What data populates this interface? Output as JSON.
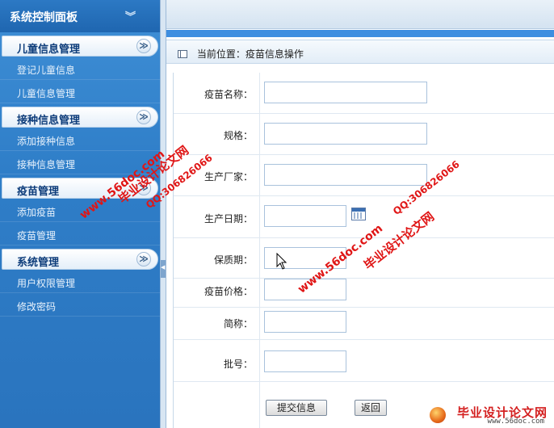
{
  "sidebar": {
    "title": "系统控制面板",
    "collapse_glyph": "≫",
    "groups": [
      {
        "title": "儿童信息管理",
        "items": [
          "登记儿童信息",
          "儿童信息管理"
        ]
      },
      {
        "title": "接种信息管理",
        "items": [
          "添加接种信息",
          "接种信息管理"
        ]
      },
      {
        "title": "疫苗管理",
        "items": [
          "添加疫苗",
          "疫苗管理"
        ]
      },
      {
        "title": "系统管理",
        "items": [
          "用户权限管理",
          "修改密码"
        ]
      }
    ]
  },
  "breadcrumb": {
    "text": "当前位置：疫苗信息操作"
  },
  "form": {
    "fields": [
      {
        "label": "疫苗名称：",
        "value": ""
      },
      {
        "label": "规格：",
        "value": ""
      },
      {
        "label": "生产厂家：",
        "value": ""
      },
      {
        "label": "生产日期：",
        "value": ""
      },
      {
        "label": "保质期：",
        "value": ""
      },
      {
        "label": "疫苗价格：",
        "value": ""
      },
      {
        "label": "简称：",
        "value": ""
      },
      {
        "label": "批号：",
        "value": ""
      }
    ],
    "submit_label": "提交信息",
    "back_label": "返回"
  },
  "watermark": {
    "site_name": "毕业设计论文网",
    "qq": "QQ:306826066",
    "url": "www.56doc.com",
    "footer_name": "毕业设计论文网",
    "footer_url": "www.56doc.com"
  },
  "icons": [
    "collapse-double-chevron-icon",
    "table-icon",
    "calendar-icon",
    "mouse-cursor-icon"
  ],
  "colors": {
    "sidebar_bg": "#2f7ec8",
    "group_text": "#0d3c7a",
    "watermark": "#e01616"
  }
}
